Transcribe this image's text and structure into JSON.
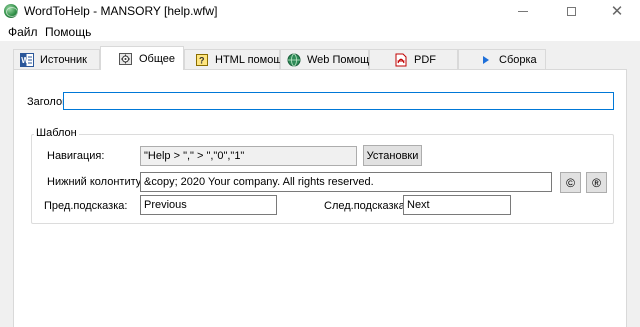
{
  "window": {
    "title": "WordToHelp  - MANSORY [help.wfw]",
    "minimize_glyph": "",
    "maximize_glyph": "",
    "close_glyph": "✕"
  },
  "menu": {
    "file": "Файл",
    "help": "Помощь"
  },
  "tabs": [
    {
      "label": "Источник",
      "icon": "word-doc-icon"
    },
    {
      "label": "Общее",
      "icon": "settings-icon",
      "active": true
    },
    {
      "label": "HTML помощь",
      "icon": "html-help-icon"
    },
    {
      "label": "Web Помощь",
      "icon": "globe-icon"
    },
    {
      "label": "PDF",
      "icon": "pdf-icon"
    },
    {
      "label": "Сборка",
      "icon": "play-arrow-icon"
    }
  ],
  "general": {
    "title_label": "Заголов",
    "title_value": ""
  },
  "template": {
    "group_label": "Шаблон",
    "nav_label": "Навигация:",
    "nav_value": "\"Help > \",\" > \",\"0\",\"1\"",
    "settings_button": "Установки",
    "footer_label": "Нижний колонтитул:",
    "footer_value": "&copy; 2020 Your company. All rights reserved.",
    "copyright_button": "©",
    "registered_button": "®",
    "prev_label": "Пред.подсказка:",
    "prev_value": "Previous",
    "next_label": "След.подсказка:",
    "next_value": "Next"
  },
  "colors": {
    "accent_focus": "#0078d7",
    "app_icon": "#2f8f46"
  }
}
